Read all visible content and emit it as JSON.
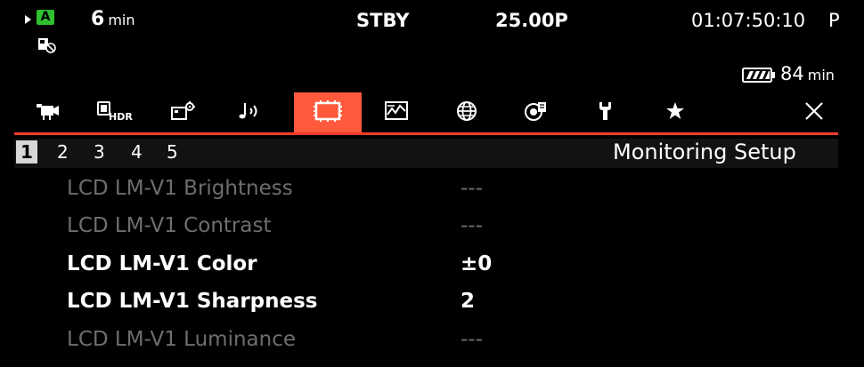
{
  "status_bar": {
    "media_slot": "A",
    "remaining_value": "6",
    "remaining_unit": "min",
    "record_status": "STBY",
    "frame_rate": "25.00P",
    "timecode": "01:07:50:10",
    "timecode_mode": "P",
    "battery_value": "84",
    "battery_unit": "min"
  },
  "tabs": [
    {
      "icon": "camera-icon"
    },
    {
      "icon": "hdr-icon"
    },
    {
      "icon": "custom-picture-icon"
    },
    {
      "icon": "audio-icon"
    },
    {
      "icon": "monitoring-icon",
      "active": true
    },
    {
      "icon": "waveform-icon"
    },
    {
      "icon": "network-icon"
    },
    {
      "icon": "recording-media-icon"
    },
    {
      "icon": "wrench-icon"
    },
    {
      "icon": "star-icon"
    },
    {
      "icon": "close-icon"
    }
  ],
  "pages": [
    "1",
    "2",
    "3",
    "4",
    "5"
  ],
  "active_page": "1",
  "menu_title": "Monitoring Setup",
  "items": [
    {
      "label": "LCD LM-V1 Brightness",
      "value": "---",
      "enabled": false
    },
    {
      "label": "LCD LM-V1 Contrast",
      "value": "---",
      "enabled": false
    },
    {
      "label": "LCD LM-V1 Color",
      "value": "±0",
      "enabled": true
    },
    {
      "label": "LCD LM-V1 Sharpness",
      "value": "2",
      "enabled": true
    },
    {
      "label": "LCD LM-V1 Luminance",
      "value": "---",
      "enabled": false
    }
  ],
  "colors": {
    "accent": "#ff5a3c",
    "underline": "#ff3a2a",
    "slot_badge": "#2fbf2f",
    "disabled_text": "#6e6e6e"
  }
}
